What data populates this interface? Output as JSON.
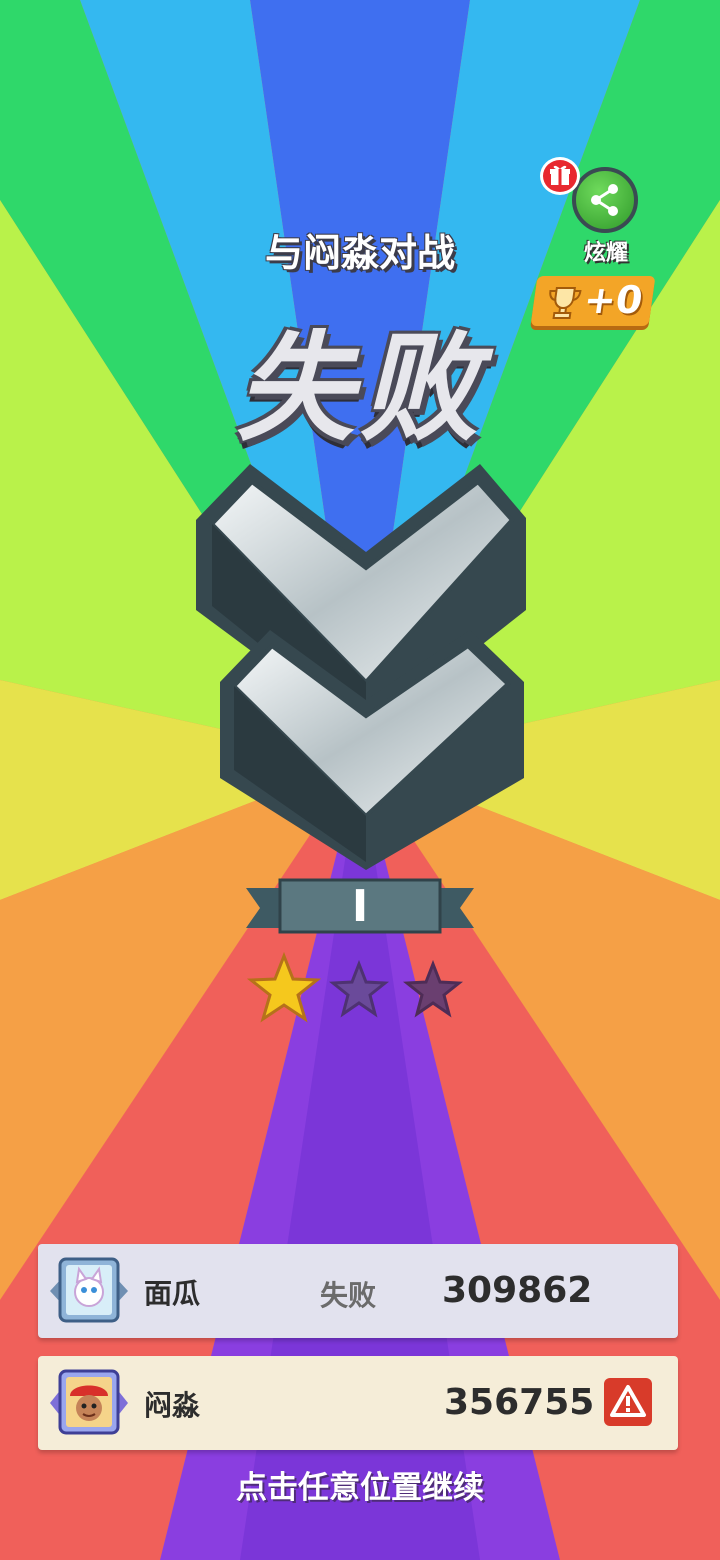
{
  "battle": {
    "title": "与闷淼对战",
    "result": "失败"
  },
  "share": {
    "label": "炫耀",
    "icon": "share-icon",
    "gift_icon": "gift-icon"
  },
  "reward": {
    "trophy_icon": "trophy-icon",
    "text": "+0"
  },
  "rank": {
    "level": "I",
    "stars_earned": 1,
    "stars_total": 3
  },
  "players": [
    {
      "name": "面瓜",
      "status": "失败",
      "score": "309862",
      "avatar": "white-cat-avatar",
      "highlighted": false
    },
    {
      "name": "闷淼",
      "status": "",
      "score": "356755",
      "avatar": "boy-red-cap-avatar",
      "highlighted": true,
      "report_icon": "warning-icon"
    }
  ],
  "footer": {
    "continue_hint": "点击任意位置继续"
  },
  "colors": {
    "ray_blue": "#3f6ff0",
    "ray_cyan": "#34b8f0",
    "ray_green": "#2fd86a",
    "ray_lime": "#b9f24a",
    "ray_yellow": "#e6e24c",
    "ray_orange": "#f5a046",
    "ray_red": "#f0605a",
    "ray_purple": "#8a3ee0",
    "star_gold": "#f5c81d",
    "star_empty": "#6a4a9a",
    "share_green": "#3aa834",
    "trophy_orange": "#f3a527",
    "report_red": "#d83b2a"
  }
}
